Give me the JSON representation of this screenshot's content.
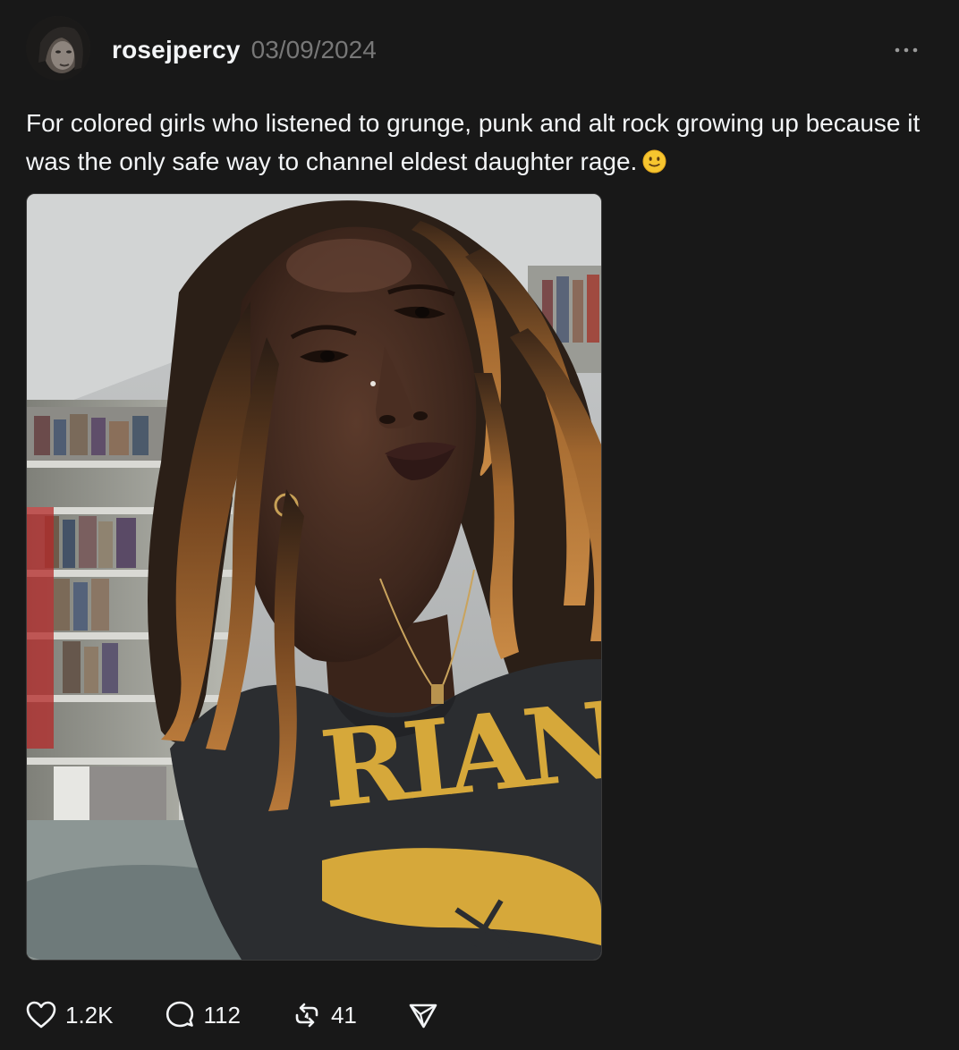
{
  "post": {
    "username": "rosejpercy",
    "timestamp": "03/09/2024",
    "caption": "For colored girls who listened to grunge, punk and alt rock growing up because it was the only safe way to channel eldest daughter rage.",
    "caption_emoji": "slightly-smiling-face-emoji",
    "image": {
      "description_icon": "photo",
      "shirt_text": "RIANA"
    }
  },
  "actions": {
    "like_count": "1.2K",
    "reply_count": "112",
    "repost_count": "41"
  },
  "icons": {
    "more": "more-horizontal-icon",
    "like": "heart-icon",
    "reply": "speech-bubble-icon",
    "repost": "repost-icon",
    "share": "send-icon"
  },
  "colors": {
    "background": "#181818",
    "text": "#f3f5f7",
    "muted": "#777777",
    "shirt_yellow": "#d6a83a"
  }
}
